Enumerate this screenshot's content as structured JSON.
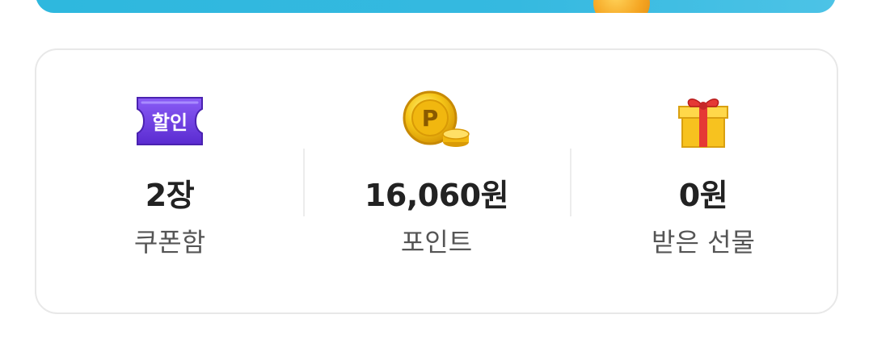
{
  "stats": [
    {
      "icon": "coupon-ticket-icon",
      "badge": "할인",
      "value": "2장",
      "label": "쿠폰함"
    },
    {
      "icon": "point-coin-icon",
      "coin_letter": "P",
      "value": "16,060원",
      "label": "포인트"
    },
    {
      "icon": "gift-box-icon",
      "value": "0원",
      "label": "받은 선물"
    }
  ],
  "colors": {
    "banner": "#35b9e0",
    "coupon": "#6a3fe0",
    "coin": "#f5c518",
    "gift": "#f7c21f",
    "ribbon": "#e53935"
  }
}
